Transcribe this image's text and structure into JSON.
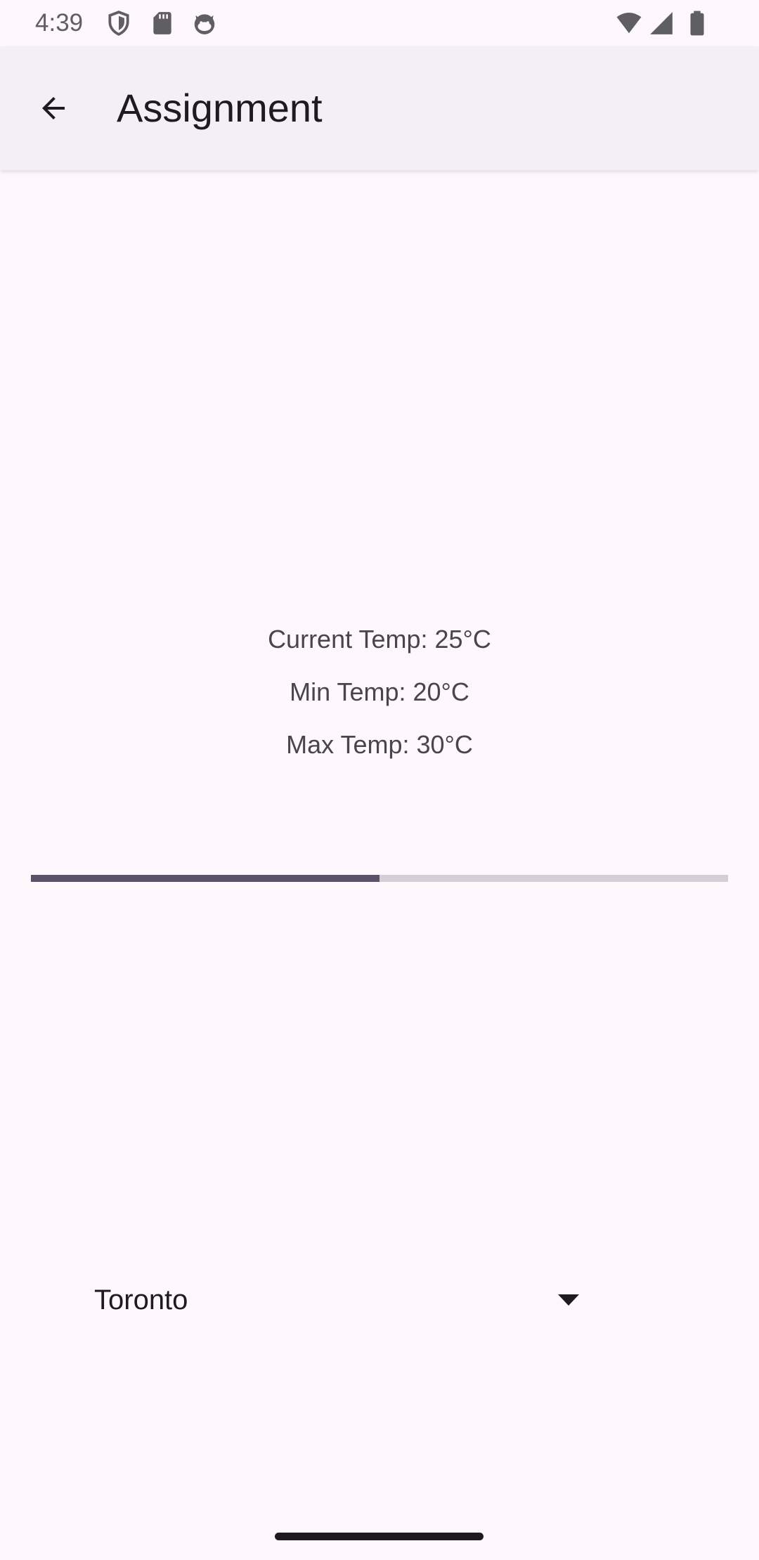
{
  "status_bar": {
    "time": "4:39",
    "icons": [
      "shield-icon",
      "sd-card-icon",
      "cat-face-icon",
      "wifi-icon",
      "signal-icon",
      "battery-icon"
    ]
  },
  "app_bar": {
    "back_icon": "arrow-back-icon",
    "title": "Assignment"
  },
  "weather": {
    "current_temp": "Current Temp: 25°C",
    "min_temp": "Min Temp: 20°C",
    "max_temp": "Max Temp: 30°C"
  },
  "progress": {
    "fraction": 0.5,
    "fill_color": "#5b5169",
    "track_color": "#d5ced6"
  },
  "city_dropdown": {
    "selected": "Toronto",
    "arrow_icon": "dropdown-arrow-icon"
  },
  "colors": {
    "background": "#fef7fb",
    "app_bar": "#f2eff6"
  }
}
